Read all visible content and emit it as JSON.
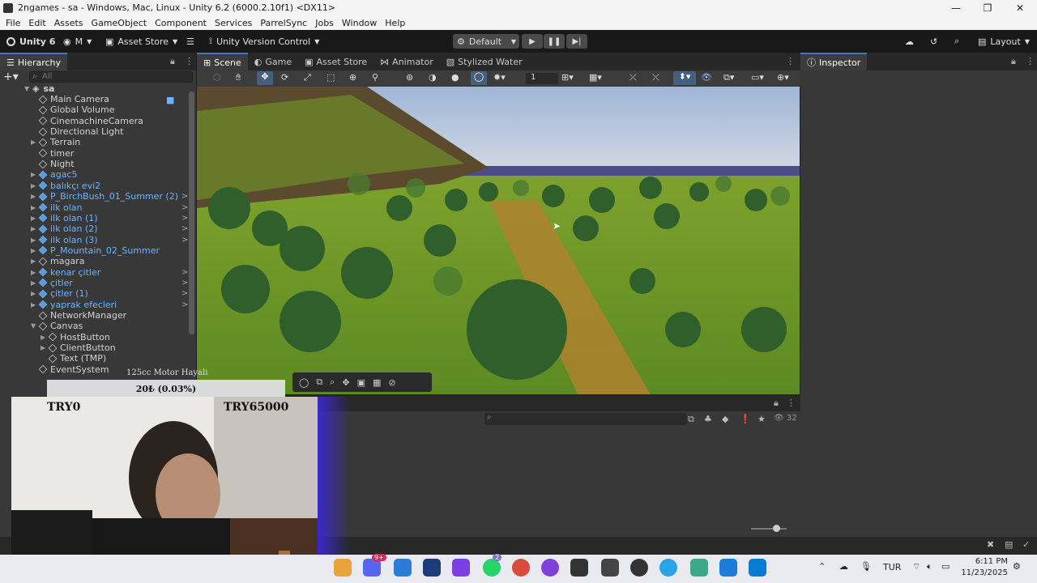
{
  "window": {
    "title": "2ngames - sa - Windows, Mac, Linux - Unity 6.2 (6000.2.10f1) <DX11>"
  },
  "menu": [
    "File",
    "Edit",
    "Assets",
    "GameObject",
    "Component",
    "Services",
    "ParrelSync",
    "Jobs",
    "Window",
    "Help"
  ],
  "toolbar": {
    "unity_label": "Unity 6",
    "account_label": "M",
    "asset_store_label": "Asset Store",
    "version_control_label": "Unity Version Control",
    "layout_preset_label": "Default",
    "layout_label": "Layout"
  },
  "hierarchy": {
    "tab": "Hierarchy",
    "search_placeholder": "All",
    "scene_name": "sa",
    "items": [
      {
        "label": "Main Camera",
        "prefab": false,
        "indent": 1,
        "expand": false,
        "more": false
      },
      {
        "label": "Global Volume",
        "prefab": false,
        "indent": 1,
        "expand": false,
        "more": false
      },
      {
        "label": "CinemachineCamera",
        "prefab": false,
        "indent": 1,
        "expand": false,
        "more": false
      },
      {
        "label": "Directional Light",
        "prefab": false,
        "indent": 1,
        "expand": false,
        "more": false
      },
      {
        "label": "Terrain",
        "prefab": false,
        "indent": 1,
        "expand": true,
        "more": false
      },
      {
        "label": "timer",
        "prefab": false,
        "indent": 1,
        "expand": false,
        "more": false
      },
      {
        "label": "Night",
        "prefab": false,
        "indent": 1,
        "expand": false,
        "more": false
      },
      {
        "label": "agac5",
        "prefab": true,
        "indent": 1,
        "expand": true,
        "more": false
      },
      {
        "label": "balıkçı evi2",
        "prefab": true,
        "indent": 1,
        "expand": true,
        "more": false
      },
      {
        "label": "P_BirchBush_01_Summer (2)",
        "prefab": true,
        "indent": 1,
        "expand": true,
        "more": true
      },
      {
        "label": "ilk olan",
        "prefab": true,
        "indent": 1,
        "expand": true,
        "more": true
      },
      {
        "label": "ilk olan (1)",
        "prefab": true,
        "indent": 1,
        "expand": true,
        "more": true
      },
      {
        "label": "ilk olan (2)",
        "prefab": true,
        "indent": 1,
        "expand": true,
        "more": true
      },
      {
        "label": "ilk olan (3)",
        "prefab": true,
        "indent": 1,
        "expand": true,
        "more": true
      },
      {
        "label": "P_Mountain_02_Summer",
        "prefab": true,
        "indent": 1,
        "expand": true,
        "more": false
      },
      {
        "label": "magara",
        "prefab": false,
        "indent": 1,
        "expand": true,
        "more": false
      },
      {
        "label": "kenar çitler",
        "prefab": true,
        "indent": 1,
        "expand": true,
        "more": true
      },
      {
        "label": "çitler",
        "prefab": true,
        "indent": 1,
        "expand": true,
        "more": true
      },
      {
        "label": "çitler (1)",
        "prefab": true,
        "indent": 1,
        "expand": true,
        "more": true
      },
      {
        "label": "yaprak efecleri",
        "prefab": true,
        "indent": 1,
        "expand": true,
        "more": true
      },
      {
        "label": "NetworkManager",
        "prefab": false,
        "indent": 1,
        "expand": false,
        "more": false
      },
      {
        "label": "Canvas",
        "prefab": false,
        "indent": 1,
        "expand": true,
        "more": false
      },
      {
        "label": "HostButton",
        "prefab": false,
        "indent": 2,
        "expand": true,
        "more": false
      },
      {
        "label": "ClientButton",
        "prefab": false,
        "indent": 2,
        "expand": true,
        "more": false
      },
      {
        "label": "Text (TMP)",
        "prefab": false,
        "indent": 2,
        "expand": false,
        "more": false
      },
      {
        "label": "EventSystem",
        "prefab": false,
        "indent": 1,
        "expand": false,
        "more": false
      }
    ]
  },
  "scene_tabs": [
    "Scene",
    "Game",
    "Asset Store",
    "Animator",
    "Stylized Water"
  ],
  "scene_toolbar": {
    "grid_value": "1"
  },
  "inspector": {
    "tab": "Inspector"
  },
  "bottom_panel": {
    "count": "32"
  },
  "overlay": {
    "donation_title": "125cc Motor Hayali",
    "donation_progress": "20₺ (0.03%)",
    "donation_min": "TRY0",
    "donation_max": "TRY65000"
  },
  "taskbar": {
    "language": "TUR",
    "time": "6:11 PM",
    "date": "11/23/2025",
    "discord_badge": "9+",
    "whatsapp_badge": "2"
  },
  "colors": {
    "accent": "#3a79bb",
    "prefab": "#6fb3ff"
  }
}
